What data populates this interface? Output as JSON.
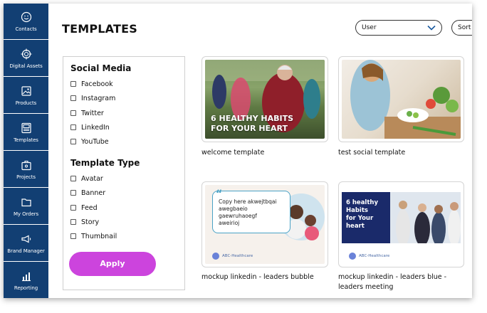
{
  "sidebar": {
    "items": [
      {
        "label": "Contacts",
        "icon": "smiley-icon"
      },
      {
        "label": "Digital Assets",
        "icon": "target-icon"
      },
      {
        "label": "Products",
        "icon": "image-icon"
      },
      {
        "label": "Templates",
        "icon": "template-icon"
      },
      {
        "label": "Projects",
        "icon": "briefcase-icon"
      },
      {
        "label": "My Orders",
        "icon": "folder-icon"
      },
      {
        "label": "Brand Manager",
        "icon": "megaphone-icon"
      },
      {
        "label": "Reporting",
        "icon": "chart-icon"
      }
    ]
  },
  "header": {
    "title": "TEMPLATES",
    "user_select": "User",
    "sort_label": "Sort"
  },
  "filters": {
    "social_heading": "Social Media",
    "social": [
      "Facebook",
      "Instagram",
      "Twitter",
      "LinkedIn",
      "YouTube"
    ],
    "type_heading": "Template Type",
    "types": [
      "Avatar",
      "Banner",
      "Feed",
      "Story",
      "Thumbnail"
    ],
    "apply_label": "Apply"
  },
  "cards": [
    {
      "title": "welcome template",
      "overlay": [
        "6 HEALTHY HABITS",
        "FOR YOUR HEART"
      ]
    },
    {
      "title": "test social template"
    },
    {
      "title": "mockup linkedin - leaders bubble",
      "bubble": [
        "Copy here akwejtbqai",
        "awegbaeio",
        "gaewruhaoegf",
        "aweirioj"
      ],
      "brand": "ABC-Healthcare"
    },
    {
      "title_line1": "mockup linkedin - leaders blue -",
      "title_line2": "leaders meeting",
      "overlay": [
        "6 healthy",
        "Habits",
        "for Your",
        "heart"
      ],
      "brand": "ABC-Healthcare"
    }
  ],
  "colors": {
    "sidebar": "#123f73",
    "apply_button": "#cc44dd",
    "bubble_border": "#4aa2c6",
    "blue_card": "#1a2a6a"
  }
}
